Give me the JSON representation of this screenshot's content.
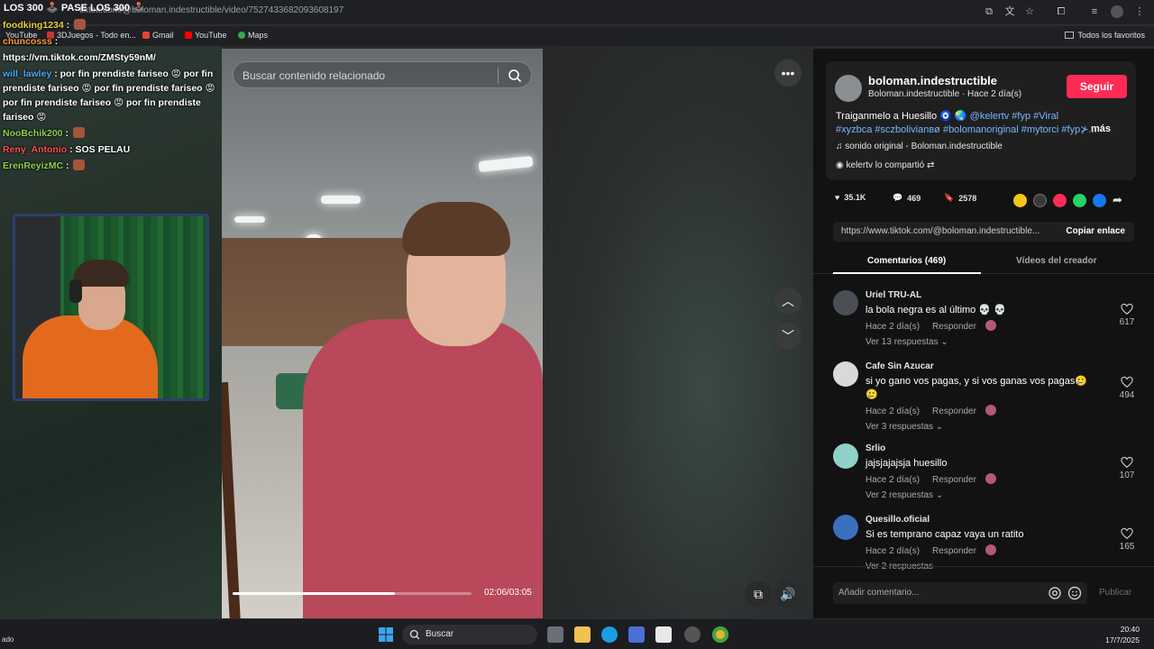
{
  "browser": {
    "stream_title": "LOS 300 🕹️ PASE LOS 300 🕹️",
    "url": "tiktok.com/@boloman.indestructible/video/7527433682093608197",
    "bookmarks": [
      "YouTube",
      "3DJuegos - Todo en...",
      "Gmail",
      "YouTube",
      "Maps"
    ],
    "all_favorites": "Todos los favoritos"
  },
  "chat": [
    {
      "user": "foodking1234",
      "text": "",
      "color": "yellow",
      "emote": true
    },
    {
      "user": "chuncosss",
      "text": "",
      "color": "orange",
      "emote": false
    },
    {
      "user": "",
      "text": "https://vm.tiktok.com/ZMSty59nM/",
      "color": "white",
      "emote": false
    },
    {
      "user": "will_lawley",
      "text": "por fin prendiste fariseo 😡 por fin prendiste fariseo 😡 por fin prendiste fariseo 😡 por fin prendiste fariseo 😡 por fin prendiste fariseo 😡",
      "color": "blue",
      "emote": false
    },
    {
      "user": "NooBchik200",
      "text": "",
      "color": "green",
      "emote": true
    },
    {
      "user": "Reny_Antonio",
      "text": "SOS PELAU",
      "color": "red",
      "emote": false
    },
    {
      "user": "ErenReyizMC",
      "text": "",
      "color": "green",
      "emote": true
    }
  ],
  "video": {
    "search_placeholder": "Buscar contenido relacionado",
    "time": "02:06/03:05",
    "progress_fraction": 0.68
  },
  "author": {
    "name": "boloman.indestructible",
    "subtitle": "Boloman.indestructible · Hace 2 día(s)",
    "follow_label": "Seguir",
    "caption_plain": "Traiganmelo a Huesillo 🧿 🌏",
    "caption_tags": "@kelertv #fyp #Viral #xyzbca #sczbolivianвø #bolomanoriginal #mytorci #fyp⊁...",
    "more_label": "más",
    "sound": "sonido original - Boloman.indestructible",
    "shared_by": "kelertv lo compartió"
  },
  "stats": {
    "likes": "35.1K",
    "comments": "469",
    "saves": "2578"
  },
  "link": {
    "url": "https://www.tiktok.com/@boloman.indestructible...",
    "copy_label": "Copiar enlace"
  },
  "tabs": {
    "comments": "Comentarios (469)",
    "creator": "Vídeos del creador"
  },
  "comments": [
    {
      "name": "Uriel TRU-AL",
      "text": "la bola negra es al último 💀 💀",
      "time": "Hace 2 día(s)",
      "reply": "Responder",
      "more": "Ver 13 respuestas ⌄",
      "likes": "617"
    },
    {
      "name": "Cafe Sin Azucar",
      "text": "si yo gano vos pagas, y si vos ganas vos pagas🥲 🥲",
      "time": "Hace 2 día(s)",
      "reply": "Responder",
      "more": "Ver 3 respuestas ⌄",
      "likes": "494"
    },
    {
      "name": "Srlio",
      "text": "jajsjajajsja huesillo",
      "time": "Hace 2 día(s)",
      "reply": "Responder",
      "more": "Ver 2 respuestas ⌄",
      "likes": "107"
    },
    {
      "name": "Quesillo.oficial",
      "text": "Si es temprano capaz vaya un ratito",
      "time": "Hace 2 día(s)",
      "reply": "Responder",
      "more": "Ver 2 respuestas",
      "likes": "165"
    }
  ],
  "composer": {
    "placeholder": "Añadir comentario...",
    "publish": "Publicar"
  },
  "taskbar": {
    "left_text": "ado",
    "search_label": "Buscar",
    "time": "20:40",
    "date": "17/7/2025"
  },
  "colors": {
    "accent": "#fe2c55",
    "panel_bg": "#121212",
    "card_bg": "#1f1f1f",
    "hashtag": "#7ab6ff"
  }
}
